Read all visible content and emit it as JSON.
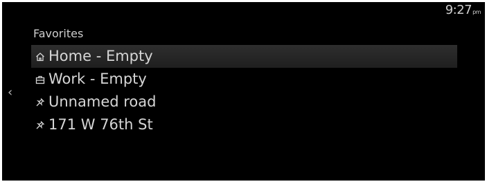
{
  "status_bar": {
    "time": "9:27",
    "ampm": "pm"
  },
  "navigation": {
    "back_icon": "chevron-left-icon"
  },
  "favorites": {
    "title": "Favorites",
    "items": [
      {
        "icon": "home-icon",
        "label": "Home - Empty",
        "selected": true
      },
      {
        "icon": "briefcase-icon",
        "label": "Work - Empty",
        "selected": false
      },
      {
        "icon": "pin-icon",
        "label": "Unnamed road",
        "selected": false
      },
      {
        "icon": "pin-icon",
        "label": "171 W 76th St",
        "selected": false
      }
    ]
  },
  "colors": {
    "background": "#000000",
    "text": "#d6d6d6",
    "selection": "#2a2a2a"
  }
}
